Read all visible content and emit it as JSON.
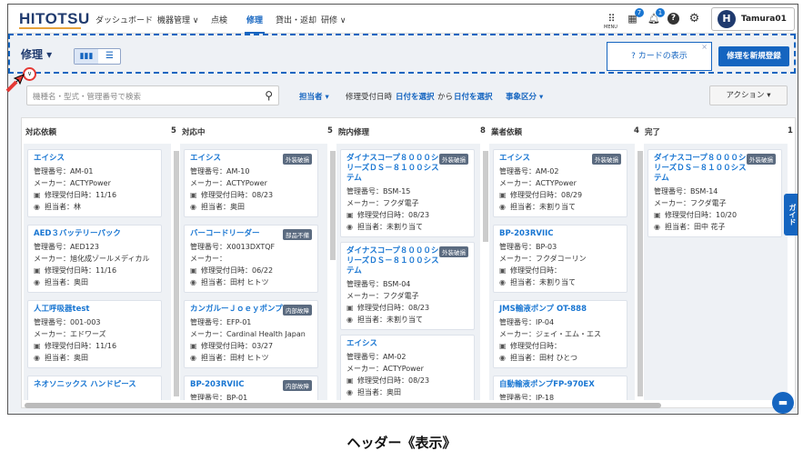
{
  "nav": {
    "logo": "HITOTSU",
    "items": [
      "ダッシュボード",
      "機器管理 ∨",
      "点検",
      "修理",
      "貸出・返却",
      "研修 ∨"
    ],
    "menu_label": "MENU",
    "badges": [
      "7",
      "1"
    ],
    "user_initial": "H",
    "user_name": "Tamura01"
  },
  "header": {
    "title": "修理 ▾",
    "view_card": "▮▮▮",
    "view_list": "☰",
    "card_toggle": "? カードの表示",
    "card_close": "×",
    "new_repair": "修理を新規登録",
    "collapse": "∨"
  },
  "filters": {
    "search_placeholder": "機種名・型式・管理番号で検索",
    "assignee": "担当者 ▾",
    "date_label": "修理受付日時",
    "date_from": "日付を選択",
    "date_sep": "から",
    "date_to": "日付を選択",
    "category": "事象区分 ▾",
    "action": "アクション ▾"
  },
  "columns": [
    {
      "title": "対応依頼",
      "count": "5"
    },
    {
      "title": "対応中",
      "count": "5"
    },
    {
      "title": "院内修理",
      "count": "8"
    },
    {
      "title": "業者依頼",
      "count": "4"
    },
    {
      "title": "完了",
      "count": "1"
    }
  ],
  "cards": {
    "c0": [
      {
        "title": "エイシス",
        "l1": "管理番号：AM-01",
        "l2": "メーカー：ACTYPower",
        "l3": "修理受付日時：11/16",
        "l4": "担当者：林"
      },
      {
        "title": "AED３バッテリーパック",
        "l1": "管理番号：AED123",
        "l2": "メーカー：旭化成ゾールメディカル",
        "l3": "修理受付日時：11/16",
        "l4": "担当者：奥田"
      },
      {
        "title": "人工呼吸器test",
        "l1": "管理番号：001-003",
        "l2": "メーカー：エドワーズ",
        "l3": "修理受付日時：11/16",
        "l4": "担当者：奥田"
      },
      {
        "title": "ネオソニックス ハンドピース",
        "l1": "",
        "l2": "",
        "l3": "",
        "l4": ""
      }
    ],
    "c1": [
      {
        "title": "エイシス",
        "tag": "外装破損",
        "l1": "管理番号：AM-10",
        "l2": "メーカー：ACTYPower",
        "l3": "修理受付日時：08/23",
        "l4": "担当者：奥田"
      },
      {
        "title": "バーコードリーダー",
        "tag": "部品不備",
        "l1": "管理番号：X0013DXTQF",
        "l2": "メーカー：",
        "l3": "修理受付日時：06/22",
        "l4": "担当者：田村 ヒトツ"
      },
      {
        "title": "カンガルーＪｏｅｙポンプ",
        "tag": "内部故障",
        "l1": "管理番号：EFP-01",
        "l2": "メーカー：Cardinal Health Japan",
        "l3": "修理受付日時：03/27",
        "l4": "担当者：田村 ヒトツ"
      },
      {
        "title": "BP-203RVIIC",
        "tag": "内部故障",
        "l1": "管理番号：BP-01",
        "l2": "",
        "l3": "",
        "l4": ""
      }
    ],
    "c2": [
      {
        "title": "ダイナスコープ８０００シリーズＤＳ－８１００システム",
        "tag": "外装破損",
        "l1": "管理番号：BSM-15",
        "l2": "メーカー：フクダ電子",
        "l3": "修理受付日時：08/23",
        "l4": "担当者：未割り当て"
      },
      {
        "title": "ダイナスコープ８０００シリーズＤＳ－８１００システム",
        "tag": "外装破損",
        "l1": "管理番号：BSM-04",
        "l2": "メーカー：フクダ電子",
        "l3": "修理受付日時：08/23",
        "l4": "担当者：未割り当て"
      },
      {
        "title": "エイシス",
        "l1": "管理番号：AM-02",
        "l2": "メーカー：ACTYPower",
        "l3": "修理受付日時：08/23",
        "l4": "担当者：奥田"
      }
    ],
    "c3": [
      {
        "title": "エイシス",
        "tag": "外装破損",
        "l1": "管理番号：AM-02",
        "l2": "メーカー：ACTYPower",
        "l3": "修理受付日時：08/29",
        "l4": "担当者：未割り当て"
      },
      {
        "title": "BP-203RVIIC",
        "l1": "管理番号：BP-03",
        "l2": "メーカー：フクダコーリン",
        "l3": "修理受付日時：",
        "l4": "担当者：未割り当て"
      },
      {
        "title": "JMS輸液ポンプ OT-888",
        "l1": "管理番号：IP-04",
        "l2": "メーカー：ジェイ・エム・エス",
        "l3": "修理受付日時：",
        "l4": "担当者：田村 ひとつ"
      },
      {
        "title": "自動輸液ポンプFP-970EX",
        "l1": "管理番号：IP-18",
        "l2": "",
        "l3": "",
        "l4": ""
      }
    ],
    "c4": [
      {
        "title": "ダイナスコープ８０００シリーズＤＳ－８１００システム",
        "tag": "外装破損",
        "l1": "管理番号：BSM-14",
        "l2": "メーカー：フクダ電子",
        "l3": "修理受付日時：10/20",
        "l4": "担当者：田中 花子"
      }
    ]
  },
  "guide": "ガイド",
  "caption": "ヘッダー《表示》"
}
